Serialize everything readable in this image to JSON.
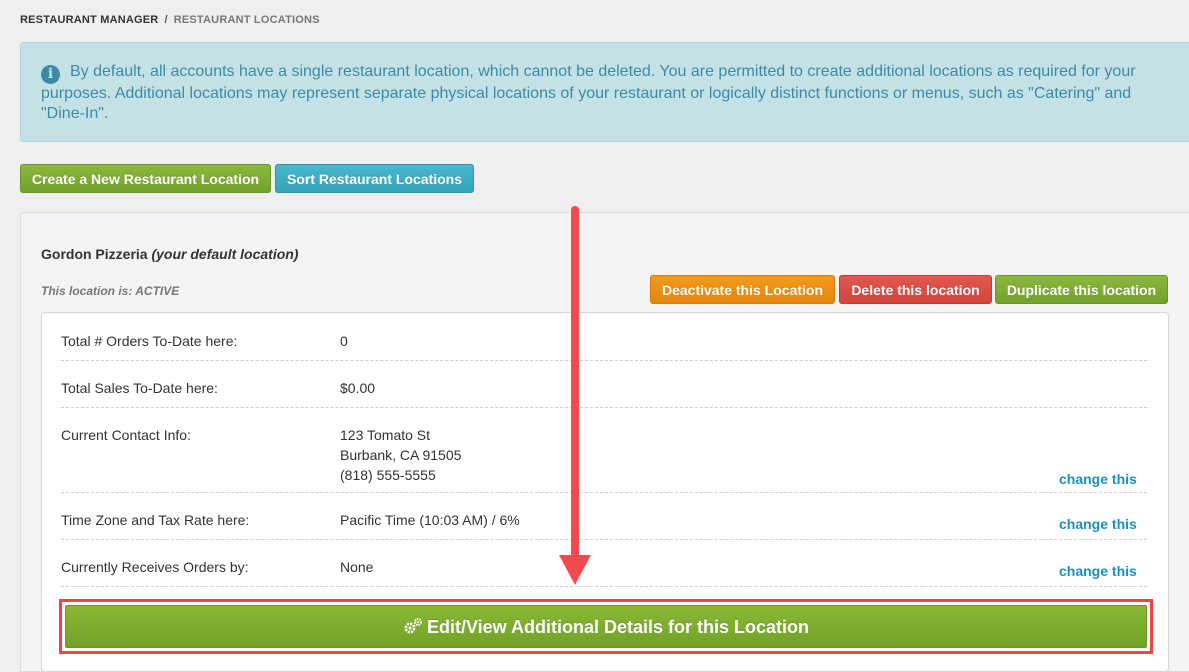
{
  "breadcrumb": {
    "root": "RESTAURANT MANAGER",
    "separator": "/",
    "current": "RESTAURANT LOCATIONS"
  },
  "info": {
    "icon": "info-circle-icon",
    "text": "By default, all accounts have a single restaurant location, which cannot be deleted. You are permitted to create additional locations as required for your purposes. Additional locations may represent separate physical locations of your restaurant or logically distinct functions or menus, such as \"Catering\" and \"Dine-In\"."
  },
  "actions": {
    "create_label": "Create a New Restaurant Location",
    "sort_label": "Sort Restaurant Locations"
  },
  "location": {
    "name": "Gordon Pizzeria",
    "default_note": "(your default location)",
    "status": "This location is: ACTIVE",
    "deactivate_label": "Deactivate this Location",
    "delete_label": "Delete this location",
    "duplicate_label": "Duplicate this location",
    "rows": [
      {
        "label": "Total # Orders To-Date here:",
        "value": "0"
      },
      {
        "label": "Total Sales To-Date here:",
        "value": "$0.00"
      },
      {
        "label": "Current Contact Info:",
        "lines": [
          "123 Tomato St",
          "Burbank, CA 91505",
          "(818) 555-5555"
        ],
        "link": "change this"
      },
      {
        "label": "Time Zone and Tax Rate here:",
        "value": "Pacific Time (10:03 AM) / 6%",
        "link": "change this"
      },
      {
        "label": "Currently Receives Orders by:",
        "value": "None",
        "link": "change this"
      }
    ],
    "edit_label": "Edit/View Additional Details for this Location"
  },
  "colors": {
    "accent_green": "#7cac2f",
    "accent_teal": "#3fadc2",
    "info_bg": "#c4e2e6",
    "link": "#1b8fc0",
    "annotation_red": "#f04a50"
  }
}
